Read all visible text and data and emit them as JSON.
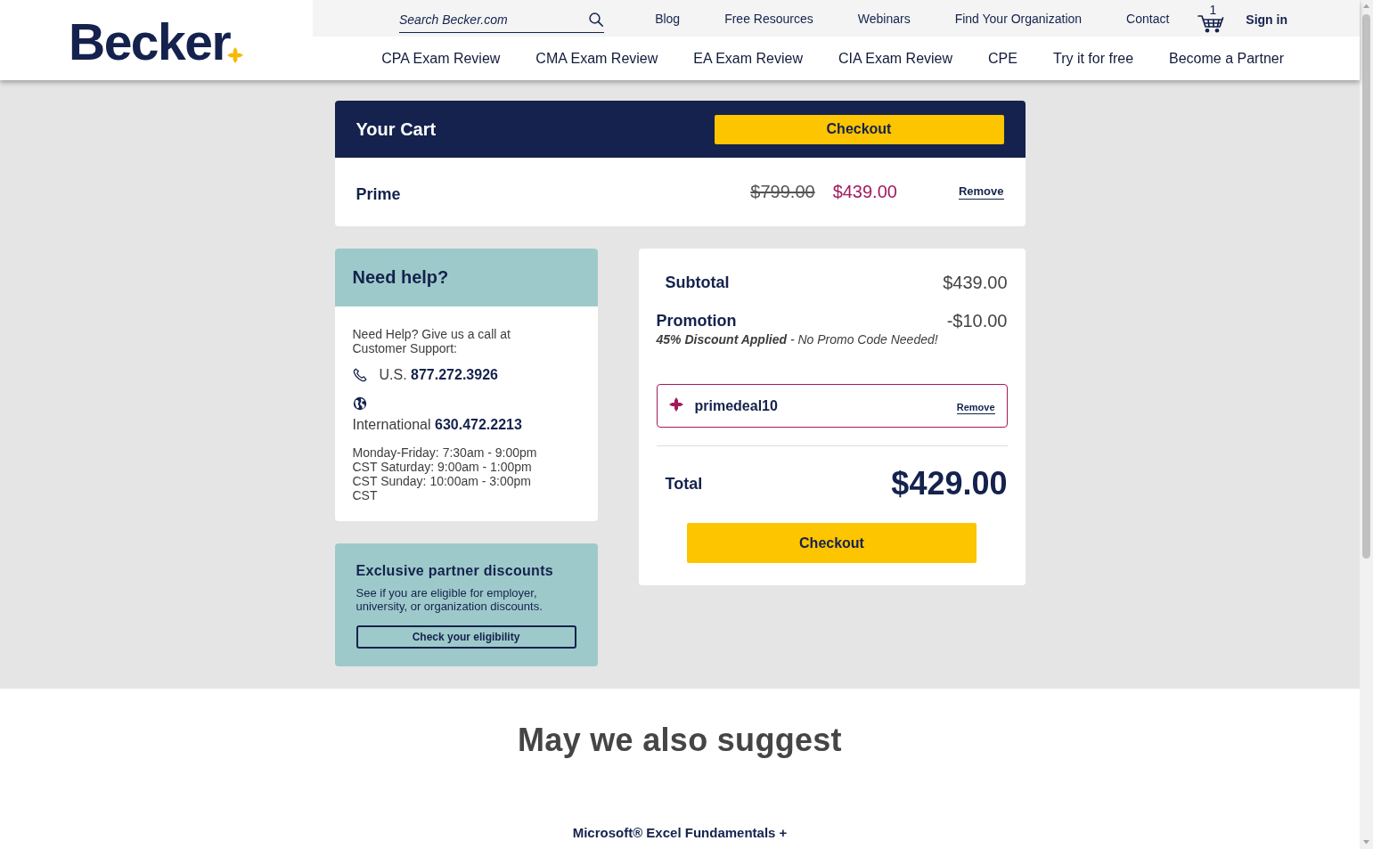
{
  "header": {
    "logo": "Becker",
    "search": {
      "placeholder": "Search Becker.com"
    },
    "utility_links": [
      "Blog",
      "Free Resources",
      "Webinars",
      "Find Your Organization",
      "Contact"
    ],
    "cart_count": "1",
    "sign_in": "Sign in",
    "nav": [
      "CPA Exam Review",
      "CMA Exam Review",
      "EA Exam Review",
      "CIA Exam Review",
      "CPE",
      "Try it for free",
      "Become a Partner"
    ]
  },
  "cart": {
    "title": "Your Cart",
    "checkout": "Checkout",
    "items": [
      {
        "name": "Prime",
        "original_price": "$799.00",
        "price": "$439.00",
        "remove": "Remove"
      }
    ]
  },
  "help": {
    "title": "Need help?",
    "intro": "Need Help? Give us a call at Customer Support:",
    "contacts": [
      {
        "kind": "phone",
        "text": "U.S. **877.272.3926**"
      },
      {
        "kind": "globe",
        "text": "International **630.472.2213**"
      }
    ],
    "hours": "Monday-Friday: 7:30am - 9:00pm CST Saturday: 9:00am - 1:00pm CST Sunday: 10:00am - 3:00pm CST"
  },
  "partner": {
    "title": "Exclusive partner discounts",
    "text": "See if you are eligible for employer, university, or organization discounts.",
    "button": "Check your eligibility"
  },
  "summary": {
    "subtotal": {
      "label": "Subtotal",
      "amount": "$439.00"
    },
    "promotion": {
      "label": "Promotion",
      "amount": "-$10.00",
      "note": "**45% Discount Applied** - No Promo Code Needed!"
    },
    "promo_code": {
      "code": "primedeal10",
      "remove": "Remove"
    },
    "total": {
      "label": "Total",
      "amount": "$429.00"
    },
    "checkout": "Checkout"
  },
  "suggestions": {
    "title": "May we also suggest",
    "products": [
      "Microsoft® Excel Fundamentals +"
    ]
  }
}
